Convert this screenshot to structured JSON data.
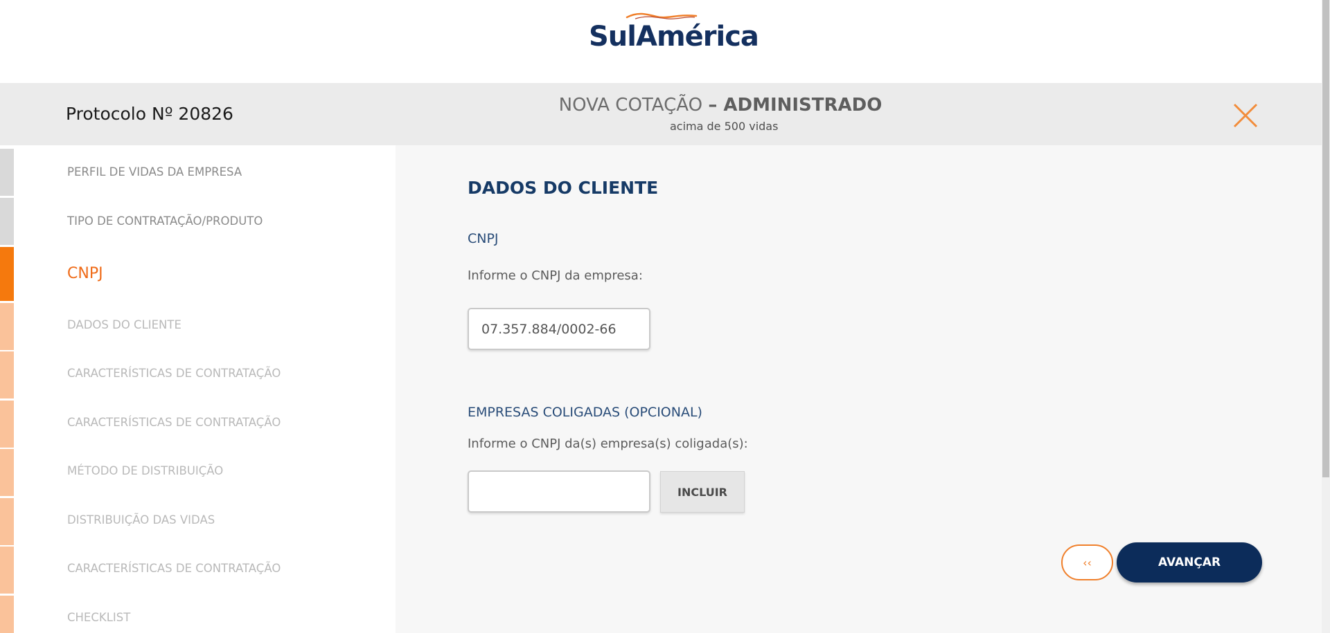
{
  "brand": {
    "logo_text": "SulAmérica",
    "colors": {
      "navy": "#0c2c5a",
      "orange": "#f5790d",
      "light_orange": "#fac29a",
      "grey": "#d9d9d9"
    }
  },
  "header": {
    "protocol": "Protocolo Nº 20826",
    "title_light": "NOVA COTAÇÃO ",
    "title_bold": "– ADMINISTRADO",
    "subtitle": "acima de 500 vidas",
    "close_icon": "close-x-icon"
  },
  "sidebar": {
    "items": [
      {
        "label": "PERFIL DE VIDAS DA EMPRESA",
        "state": "done"
      },
      {
        "label": "TIPO DE CONTRATAÇÃO/PRODUTO",
        "state": "done"
      },
      {
        "label": "CNPJ",
        "state": "active"
      },
      {
        "label": "DADOS DO CLIENTE",
        "state": "todo"
      },
      {
        "label": "CARACTERÍSTICAS DE CONTRATAÇÃO",
        "state": "todo"
      },
      {
        "label": "CARACTERÍSTICAS DE CONTRATAÇÃO",
        "state": "todo"
      },
      {
        "label": "MÉTODO DE DISTRIBUIÇÃO",
        "state": "todo"
      },
      {
        "label": "DISTRIBUIÇÃO DAS VIDAS",
        "state": "todo"
      },
      {
        "label": "CARACTERÍSTICAS DE CONTRATAÇÃO",
        "state": "todo"
      },
      {
        "label": "CHECKLIST",
        "state": "todo"
      }
    ]
  },
  "main": {
    "section_title": "DADOS DO CLIENTE",
    "cnpj": {
      "heading": "CNPJ",
      "help": "Informe o CNPJ da empresa:",
      "value": "07.357.884/0002-66"
    },
    "coligadas": {
      "heading": "EMPRESAS COLIGADAS (OPCIONAL)",
      "help": "Informe o CNPJ da(s) empresa(s) coligada(s):",
      "value": "",
      "include_label": "INCLUIR"
    },
    "back_label": "‹‹",
    "next_label": "AVANÇAR"
  }
}
